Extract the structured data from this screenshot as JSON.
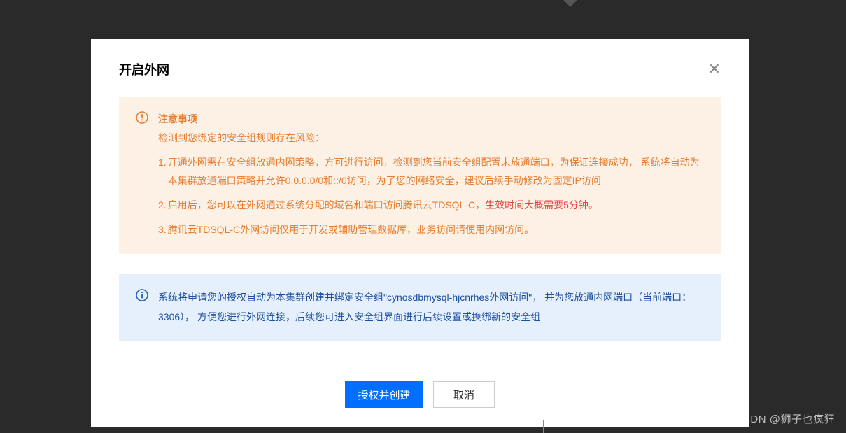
{
  "modal": {
    "title": "开启外网",
    "warning": {
      "heading": "注意事项",
      "subtitle": "检测到您绑定的安全组规则存在风险：",
      "items": [
        {
          "num": "1.",
          "text": "开通外网需在安全组放通内网策略，方可进行访问，检测到您当前安全组配置未放通端口，为保证连接成功， 系统将自动为本集群放通端口策略并允许0.0.0.0/0和::/0访问，为了您的网络安全，建议后续手动修改为固定IP访问"
        },
        {
          "num": "2.",
          "text_pre": "启用后，您可以在外网通过系统分配的域名和端口访问腾讯云TDSQL-C，",
          "red": "生效时间大概需要5分钟",
          "text_post": "。"
        },
        {
          "num": "3.",
          "text": "腾讯云TDSQL-C外网访问仅用于开发或辅助管理数据库，业务访问请使用内网访问。"
        }
      ]
    },
    "info": "系统将申请您的授权自动为本集群创建并绑定安全组\"cynosdbmysql-hjcnrhes外网访问\"， 并为您放通内网端口（当前端口： 3306）， 方便您进行外网连接，后续您可进入安全组界面进行后续设置或换绑新的安全组",
    "buttons": {
      "primary": "授权并创建",
      "cancel": "取消"
    }
  },
  "watermark": "CSDN @狮子也疯狂"
}
